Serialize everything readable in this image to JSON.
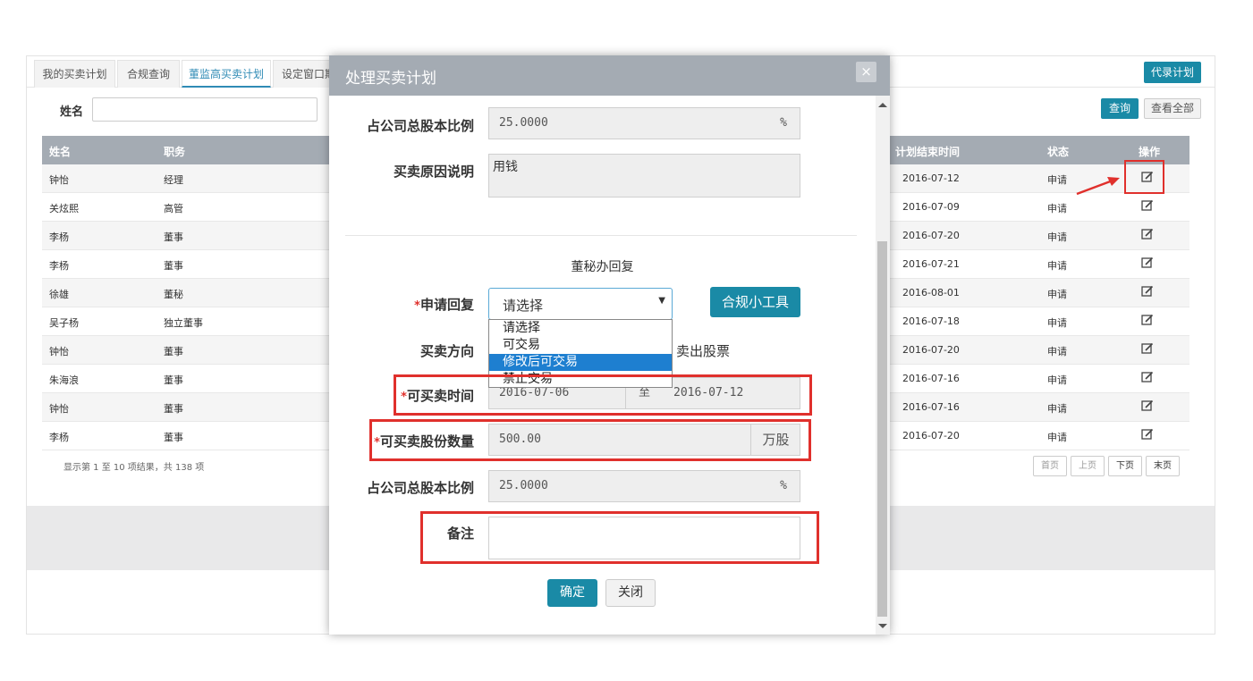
{
  "tabs": [
    "我的买卖计划",
    "合规查询",
    "董监高买卖计划",
    "设定窗口期"
  ],
  "top_right_button": "代录计划",
  "search": {
    "label": "姓名",
    "value": ""
  },
  "query_button": "查询",
  "view_all_button": "查看全部",
  "table": {
    "headers": [
      "姓名",
      "职务",
      "计划结束时间",
      "状态",
      "操作"
    ],
    "rows": [
      {
        "name": "钟怡",
        "role": "经理",
        "end": "2016-07-12",
        "status": "申请"
      },
      {
        "name": "关炫熙",
        "role": "高管",
        "end": "2016-07-09",
        "status": "申请"
      },
      {
        "name": "李杨",
        "role": "董事",
        "end": "2016-07-20",
        "status": "申请"
      },
      {
        "name": "李杨",
        "role": "董事",
        "end": "2016-07-21",
        "status": "申请"
      },
      {
        "name": "徐雄",
        "role": "董秘",
        "end": "2016-08-01",
        "status": "申请"
      },
      {
        "name": "吴子杨",
        "role": "独立董事",
        "end": "2016-07-18",
        "status": "申请"
      },
      {
        "name": "钟怡",
        "role": "董事",
        "end": "2016-07-20",
        "status": "申请"
      },
      {
        "name": "朱海浪",
        "role": "董事",
        "end": "2016-07-16",
        "status": "申请"
      },
      {
        "name": "钟怡",
        "role": "董事",
        "end": "2016-07-16",
        "status": "申请"
      },
      {
        "name": "李杨",
        "role": "董事",
        "end": "2016-07-20",
        "status": "申请"
      }
    ]
  },
  "pagination": {
    "summary": "显示第 1 至 10 项结果，共 138 项",
    "buttons": [
      "首页",
      "上页",
      "下页",
      "末页"
    ]
  },
  "modal": {
    "title": "处理买卖计划",
    "close_glyph": "×",
    "ratio_label_top": "占公司总股本比例",
    "ratio_value_top": "25.0000",
    "percent_unit": "%",
    "reason_label": "买卖原因说明",
    "reason_value": "用钱",
    "section_title": "董秘办回复",
    "reply_label": "申请回复",
    "reply_selected": "请选择",
    "reply_options": [
      "请选择",
      "可交易",
      "修改后可交易",
      "禁止交易"
    ],
    "compliance_tool_button": "合规小工具",
    "direction_label": "买卖方向",
    "direction_value": "卖出股票",
    "time_label": "可买卖时间",
    "time_start": "2016-07-06",
    "time_sep": "至",
    "time_end": "2016-07-12",
    "quantity_label": "可买卖股份数量",
    "quantity_value": "500.00",
    "quantity_unit": "万股",
    "ratio_label_bottom": "占公司总股本比例",
    "ratio_value_bottom": "25.0000",
    "remark_label": "备注",
    "remark_value": "",
    "confirm_button": "确定",
    "close_button": "关闭",
    "required_mark": "*"
  },
  "colors": {
    "accent": "#1a8aa6",
    "highlight": "#e0302c",
    "header_gray": "#a4abb3"
  }
}
